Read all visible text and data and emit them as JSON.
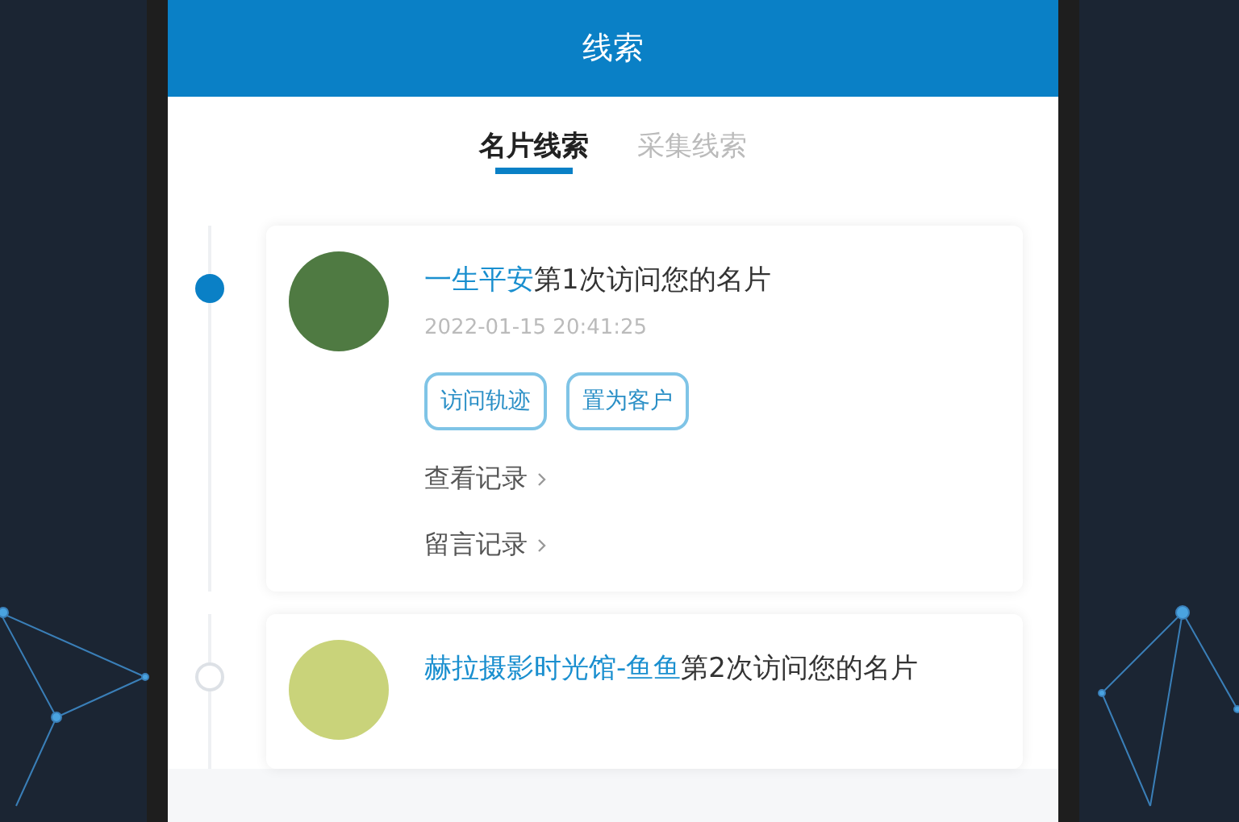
{
  "header": {
    "title": "线索"
  },
  "tabs": [
    {
      "label": "名片线索",
      "selected": true
    },
    {
      "label": "采集线索",
      "selected": false
    }
  ],
  "entries": [
    {
      "current": true,
      "visitor": "一生平安",
      "message": "第1次访问您的名片",
      "time": "2022-01-15 20:41:25",
      "actions": [
        "访问轨迹",
        "置为客户"
      ],
      "links": [
        "查看记录",
        "留言记录"
      ]
    },
    {
      "current": false,
      "visitor": "赫拉摄影时光馆-鱼鱼",
      "message": "第2次访问您的名片"
    }
  ]
}
